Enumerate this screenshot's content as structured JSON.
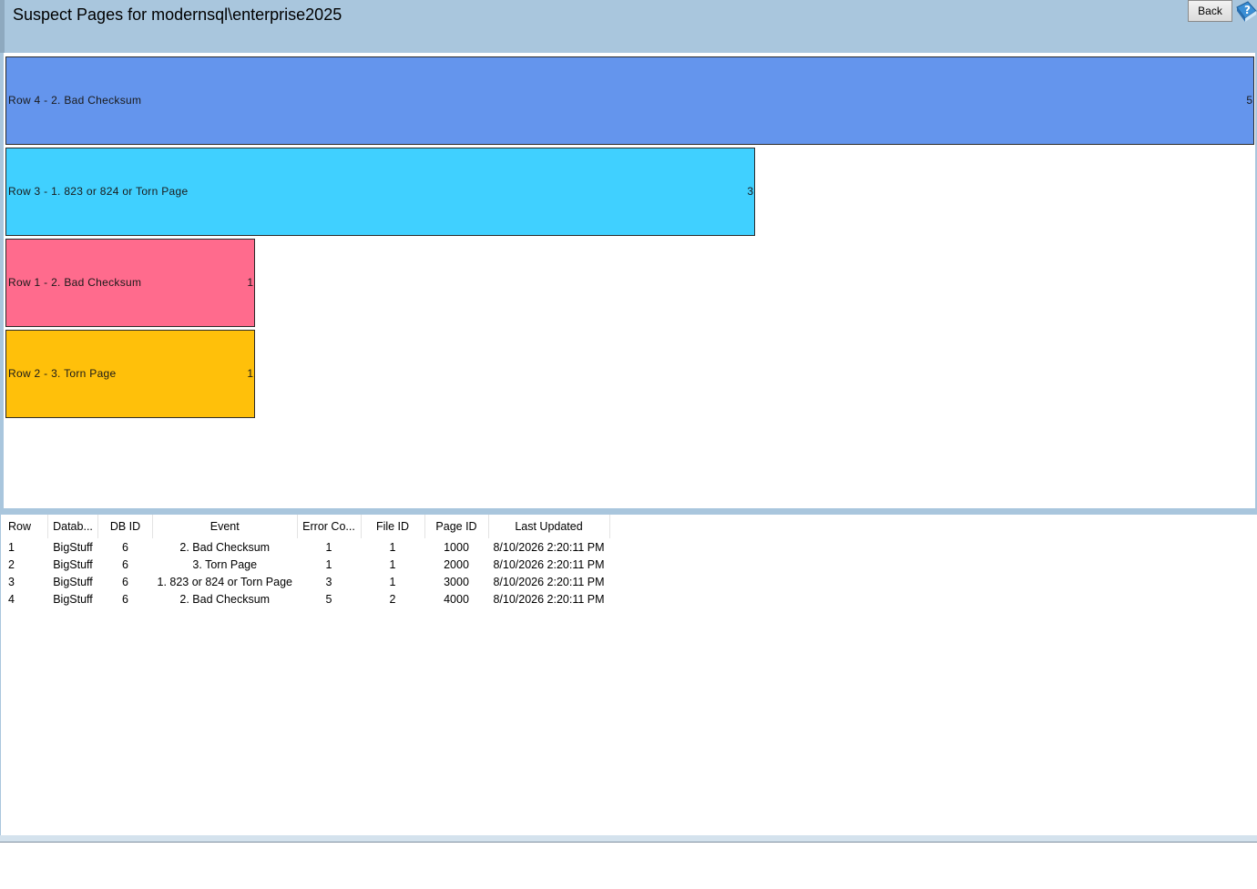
{
  "header": {
    "title": "Suspect Pages for modernsql\\enterprise2025",
    "back_label": "Back",
    "help_icon": "help-book-icon"
  },
  "chart_data": {
    "type": "bar",
    "orientation": "horizontal",
    "categories": [
      "Row 4 - 2. Bad Checksum",
      "Row 3 - 1. 823 or 824 or Torn Page",
      "Row 1 - 2. Bad Checksum",
      "Row 2 - 3. Torn Page"
    ],
    "values": [
      5,
      3,
      1,
      1
    ],
    "colors": [
      "#6495ed",
      "#40d0ff",
      "#ff6b8d",
      "#ffc00a"
    ],
    "value_labels": [
      "5",
      "3",
      "1",
      "1"
    ],
    "xlim": [
      0,
      5
    ]
  },
  "table": {
    "columns": [
      "Row",
      "Datab...",
      "DB ID",
      "Event",
      "Error Co...",
      "File ID",
      "Page ID",
      "Last Updated"
    ],
    "rows": [
      [
        "1",
        "BigStuff",
        "6",
        "2. Bad Checksum",
        "1",
        "1",
        "1000",
        "8/10/2026 2:20:11 PM"
      ],
      [
        "2",
        "BigStuff",
        "6",
        "3. Torn Page",
        "1",
        "1",
        "2000",
        "8/10/2026 2:20:11 PM"
      ],
      [
        "3",
        "BigStuff",
        "6",
        "1. 823 or 824 or Torn Page",
        "3",
        "1",
        "3000",
        "8/10/2026 2:20:11 PM"
      ],
      [
        "4",
        "BigStuff",
        "6",
        "2. Bad Checksum",
        "5",
        "2",
        "4000",
        "8/10/2026 2:20:11 PM"
      ]
    ]
  }
}
